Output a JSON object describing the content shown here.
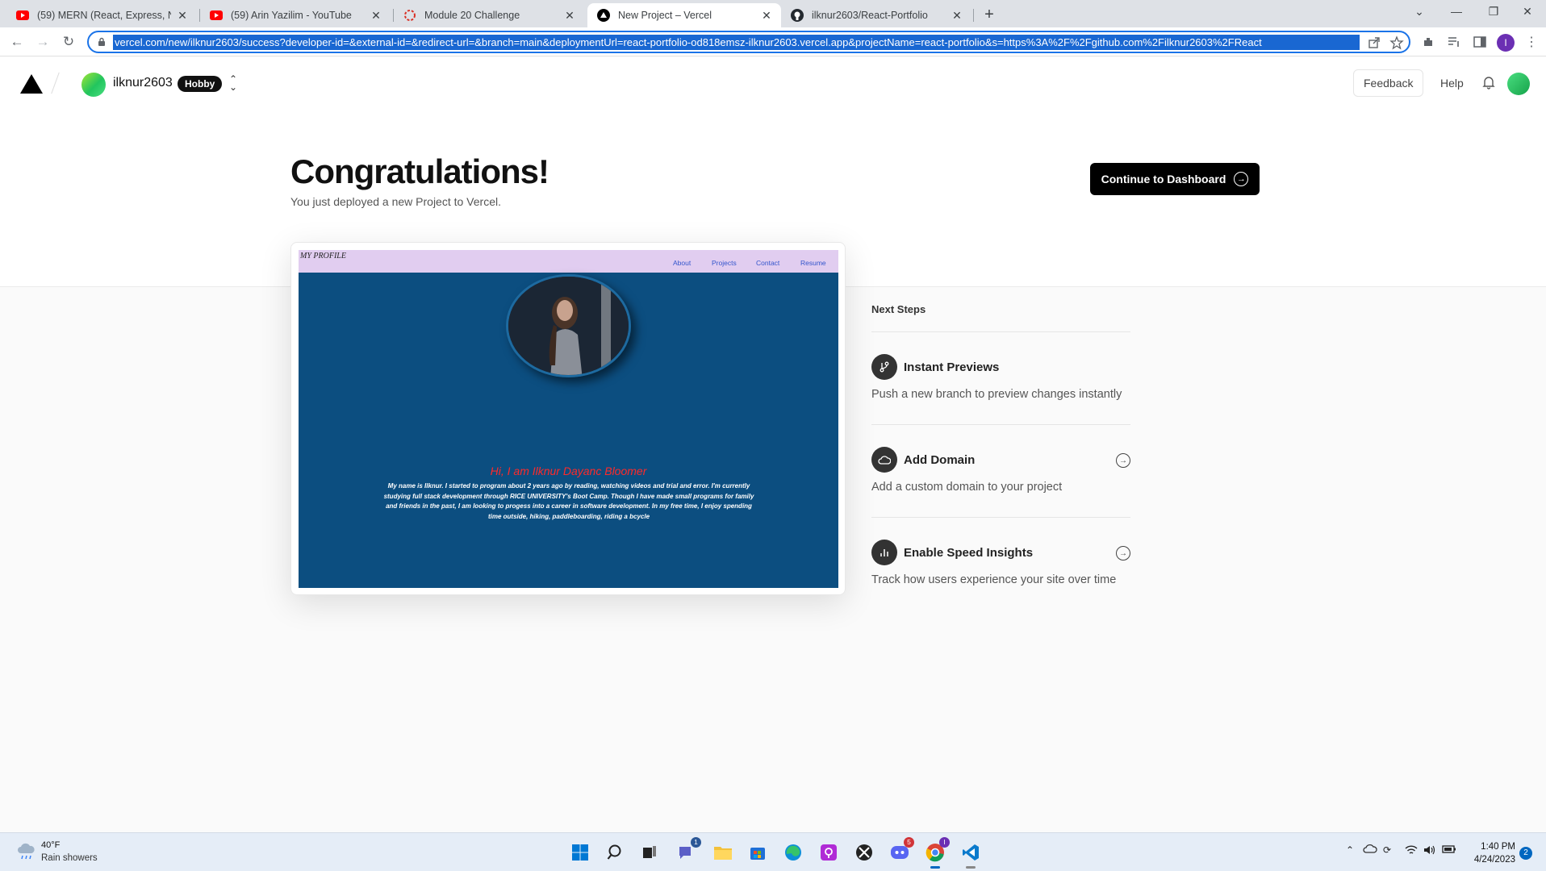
{
  "browser": {
    "tabs": [
      {
        "title": "(59) MERN (React, Express, Node",
        "icon": "youtube-icon"
      },
      {
        "title": "(59) Arin Yazilim - YouTube",
        "icon": "youtube-icon"
      },
      {
        "title": "Module 20 Challenge",
        "icon": "challenge-icon"
      },
      {
        "title": "New Project – Vercel",
        "icon": "vercel-icon"
      },
      {
        "title": "ilknur2603/React-Portfolio",
        "icon": "github-icon"
      }
    ],
    "active_tab": 3,
    "url": "vercel.com/new/ilknur2603/success?developer-id=&external-id=&redirect-url=&branch=main&deploymentUrl=react-portfolio-od818emsz-ilknur2603.vercel.app&projectName=react-portfolio&s=https%3A%2F%2Fgithub.com%2Filknur2603%2FReact",
    "profile_initial": "I"
  },
  "vercel": {
    "team_name": "ilknur2603",
    "plan_badge": "Hobby",
    "feedback_label": "Feedback",
    "help_label": "Help"
  },
  "hero": {
    "title": "Congratulations!",
    "subtitle": "You just deployed a new Project to Vercel.",
    "cta_label": "Continue to Dashboard"
  },
  "preview": {
    "brand": "MY PROFILE",
    "nav": [
      "About",
      "Projects",
      "Contact",
      "Resume"
    ],
    "heading": "Hi, I am Ilknur Dayanc Bloomer",
    "bio": "My name is Ilknur. I started to program about 2 years ago by reading, watching videos and trial and error. I'm currently studying full stack development through RICE UNIVERSITY's Boot Camp. Though I have made small programs for family and friends in the past, I am looking to progess into a career in software development. In my free time, I enjoy spending time outside, hiking, paddleboarding, riding a bcycle"
  },
  "next_steps": {
    "title": "Next Steps",
    "items": [
      {
        "name": "Instant Previews",
        "desc": "Push a new branch to preview changes instantly",
        "icon": "git-branch-icon",
        "has_arrow": false
      },
      {
        "name": "Add Domain",
        "desc": "Add a custom domain to your project",
        "icon": "cloud-icon",
        "has_arrow": true
      },
      {
        "name": "Enable Speed Insights",
        "desc": "Track how users experience your site over time",
        "icon": "bar-chart-icon",
        "has_arrow": true
      }
    ]
  },
  "taskbar": {
    "temperature": "40°F",
    "weather": "Rain showers",
    "time": "1:40 PM",
    "date": "4/24/2023",
    "notification_count": "2",
    "teams_badge": "1",
    "discord_badge": "5"
  },
  "colors": {
    "omnibox_selection": "#1967d2",
    "preview_bg": "#0c4e80",
    "preview_nav": "#e1cdf0",
    "preview_heading": "#ff2a2a"
  }
}
